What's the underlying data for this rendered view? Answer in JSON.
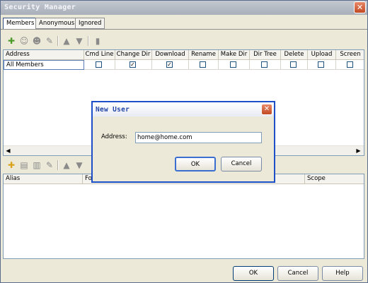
{
  "window": {
    "title": "Security Manager",
    "close_glyph": "✕"
  },
  "tabs": [
    {
      "label": "Members",
      "active": true
    },
    {
      "label": "Anonymous",
      "active": false
    },
    {
      "label": "Ignored",
      "active": false
    }
  ],
  "toolbar_top": {
    "icons": [
      "add-user-icon",
      "edit-user-icon",
      "remove-user-icon",
      "eraser-icon",
      "move-up-icon",
      "move-down-icon",
      "delete-icon"
    ]
  },
  "members_table": {
    "columns": [
      "Address",
      "Cmd Line",
      "Change Dir",
      "Download",
      "Rename",
      "Make Dir",
      "Dir Tree",
      "Delete",
      "Upload",
      "Screen"
    ],
    "rows": [
      {
        "address": "All Members",
        "checks": [
          false,
          true,
          true,
          false,
          false,
          false,
          false,
          false,
          false
        ]
      }
    ]
  },
  "toolbar_bottom": {
    "icons": [
      "add-alias-icon",
      "edit-alias-icon",
      "remove-alias-icon",
      "eraser-icon",
      "move-up-icon",
      "move-down-icon"
    ]
  },
  "alias_table": {
    "columns": [
      "Alias",
      "Fo",
      "Scope"
    ]
  },
  "buttons": {
    "ok": "OK",
    "cancel": "Cancel",
    "help": "Help"
  },
  "dialog": {
    "title": "New User",
    "address_label": "Address:",
    "address_value": "home@home.com",
    "ok_label": "OK",
    "cancel_label": "Cancel",
    "close_glyph": "✕"
  },
  "colors": {
    "dialog_border": "#1d50c8",
    "close_button": "#c24a23",
    "window_bg": "#ece9d8"
  }
}
